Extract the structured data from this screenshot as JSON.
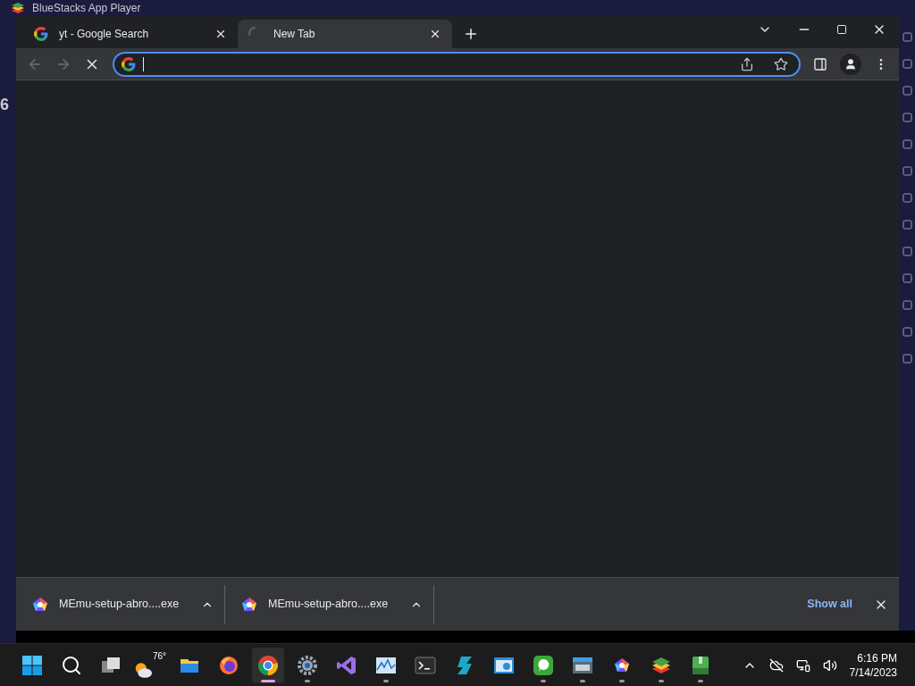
{
  "background_window": {
    "title": "BlueStacks App Player",
    "side_text": "6"
  },
  "browser": {
    "tabs": [
      {
        "title": "yt - Google Search",
        "selected": false,
        "loading": false
      },
      {
        "title": "New Tab",
        "selected": true,
        "loading": true
      }
    ],
    "toolbar": {
      "back_disabled": true,
      "forward_disabled": true,
      "loading": true,
      "address_focused": true
    },
    "downloads": [
      {
        "filename": "MEmu-setup-abro....exe"
      },
      {
        "filename": "MEmu-setup-abro....exe"
      }
    ],
    "show_all": "Show all"
  },
  "taskbar": {
    "weather_temp": "76°",
    "apps": [
      {
        "kind": "start",
        "running": false,
        "active": false
      },
      {
        "kind": "search",
        "running": false,
        "active": false
      },
      {
        "kind": "taskview",
        "running": false,
        "active": false
      },
      {
        "kind": "weather",
        "running": false,
        "active": false
      },
      {
        "kind": "folder",
        "running": false,
        "active": false
      },
      {
        "kind": "firefox",
        "running": false,
        "active": false
      },
      {
        "kind": "chrome",
        "running": true,
        "active": true
      },
      {
        "kind": "gear",
        "running": true,
        "active": false
      },
      {
        "kind": "studio",
        "running": false,
        "active": false
      },
      {
        "kind": "monitor",
        "running": true,
        "active": false
      },
      {
        "kind": "terminal",
        "running": false,
        "active": false
      },
      {
        "kind": "cube",
        "running": false,
        "active": false
      },
      {
        "kind": "dashboard",
        "running": false,
        "active": false
      },
      {
        "kind": "chat",
        "running": true,
        "active": false
      },
      {
        "kind": "window",
        "running": true,
        "active": false
      },
      {
        "kind": "memu",
        "running": true,
        "active": false
      },
      {
        "kind": "layers",
        "running": true,
        "active": false
      },
      {
        "kind": "archive",
        "running": true,
        "active": false
      }
    ],
    "time": "6:16 PM",
    "date": "7/14/2023"
  }
}
